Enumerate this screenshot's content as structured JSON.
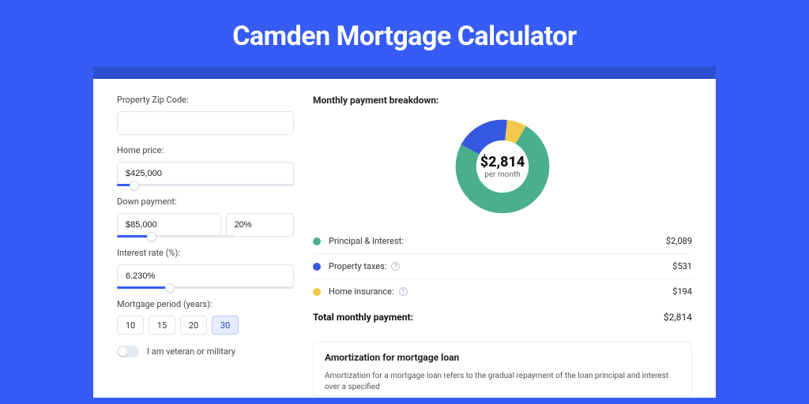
{
  "title": "Camden Mortgage Calculator",
  "form": {
    "zip_label": "Property Zip Code:",
    "zip_value": "",
    "price_label": "Home price:",
    "price_value": "$425,000",
    "price_slider_pct": 10,
    "down_label": "Down payment:",
    "down_value": "$85,000",
    "down_pct": "20%",
    "down_slider_pct": 20,
    "rate_label": "Interest rate (%):",
    "rate_value": "6.230%",
    "rate_slider_pct": 30,
    "period_label": "Mortgage period (years):",
    "periods": [
      "10",
      "15",
      "20",
      "30"
    ],
    "period_active": "30",
    "veteran_label": "I am veteran or military"
  },
  "breakdown": {
    "title": "Monthly payment breakdown:",
    "amount": "$2,814",
    "sub": "per month",
    "items": [
      {
        "label": "Principal & Interest:",
        "value": "$2,089",
        "color": "#4aaf8a",
        "help": false
      },
      {
        "label": "Property taxes:",
        "value": "$531",
        "color": "#3559e0",
        "help": true
      },
      {
        "label": "Home insurance:",
        "value": "$194",
        "color": "#f2c94c",
        "help": true
      }
    ],
    "total_label": "Total monthly payment:",
    "total_value": "$2,814"
  },
  "chart_data": {
    "type": "pie",
    "title": "Monthly payment breakdown",
    "series": [
      {
        "name": "Principal & Interest",
        "value": 2089,
        "color": "#4aaf8a"
      },
      {
        "name": "Property taxes",
        "value": 531,
        "color": "#3559e0"
      },
      {
        "name": "Home insurance",
        "value": 194,
        "color": "#f2c94c"
      }
    ],
    "total": 2814
  },
  "amort": {
    "title": "Amortization for mortgage loan",
    "text": "Amortization for a mortgage loan refers to the gradual repayment of the loan principal and interest over a specified"
  }
}
